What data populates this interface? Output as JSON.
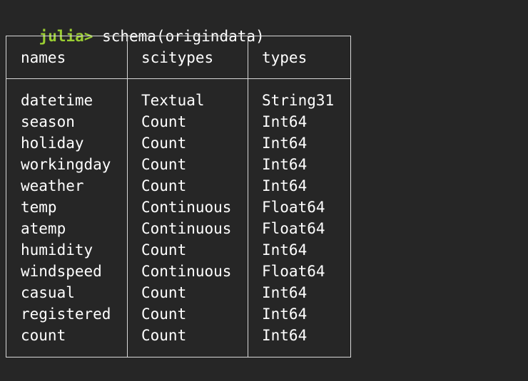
{
  "repl": {
    "prompt": "julia>",
    "command": "schema(origindata)"
  },
  "table": {
    "headers": [
      "names",
      "scitypes",
      "types"
    ],
    "rows": [
      [
        "datetime",
        "Textual",
        "String31"
      ],
      [
        "season",
        "Count",
        "Int64"
      ],
      [
        "holiday",
        "Count",
        "Int64"
      ],
      [
        "workingday",
        "Count",
        "Int64"
      ],
      [
        "weather",
        "Count",
        "Int64"
      ],
      [
        "temp",
        "Continuous",
        "Float64"
      ],
      [
        "atemp",
        "Continuous",
        "Float64"
      ],
      [
        "humidity",
        "Count",
        "Int64"
      ],
      [
        "windspeed",
        "Continuous",
        "Float64"
      ],
      [
        "casual",
        "Count",
        "Int64"
      ],
      [
        "registered",
        "Count",
        "Int64"
      ],
      [
        "count",
        "Count",
        "Int64"
      ]
    ]
  },
  "colors": {
    "background": "#262626",
    "prompt": "#9ACD32",
    "text": "#ffffff",
    "border": "#d8d8d8"
  }
}
